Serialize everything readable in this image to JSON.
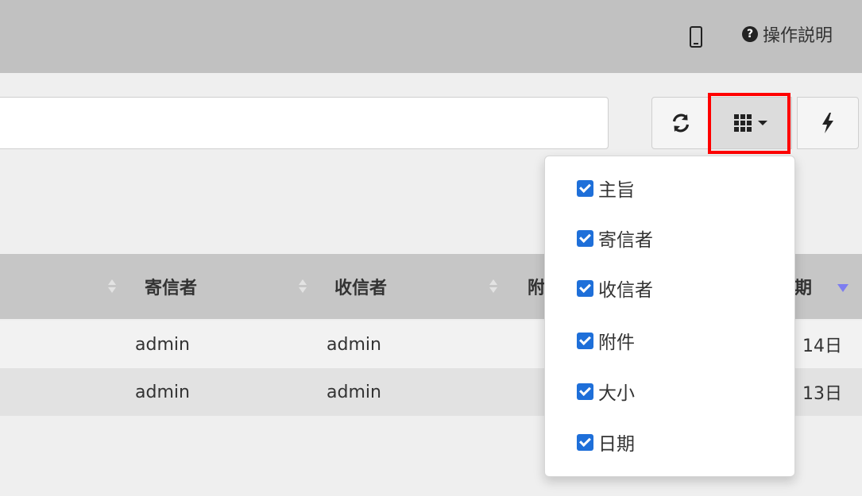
{
  "header": {
    "help_label": "操作説明",
    "help_icon": "?"
  },
  "toolbar": {
    "search_value": ""
  },
  "table": {
    "columns": [
      "寄信者",
      "收信者",
      "附",
      "期"
    ],
    "rows": [
      {
        "sender": "admin",
        "recipient": "admin",
        "date_fragment": "14日"
      },
      {
        "sender": "admin",
        "recipient": "admin",
        "date_fragment": "13日"
      }
    ]
  },
  "column_menu": {
    "items": [
      {
        "label": "主旨",
        "checked": true
      },
      {
        "label": "寄信者",
        "checked": true
      },
      {
        "label": "收信者",
        "checked": true
      },
      {
        "label": "附件",
        "checked": true
      },
      {
        "label": "大小",
        "checked": true
      },
      {
        "label": "日期",
        "checked": true
      }
    ]
  },
  "colors": {
    "accent": "#1e6fd9",
    "highlight": "#ff0000",
    "sort_active": "#7d7df0"
  }
}
